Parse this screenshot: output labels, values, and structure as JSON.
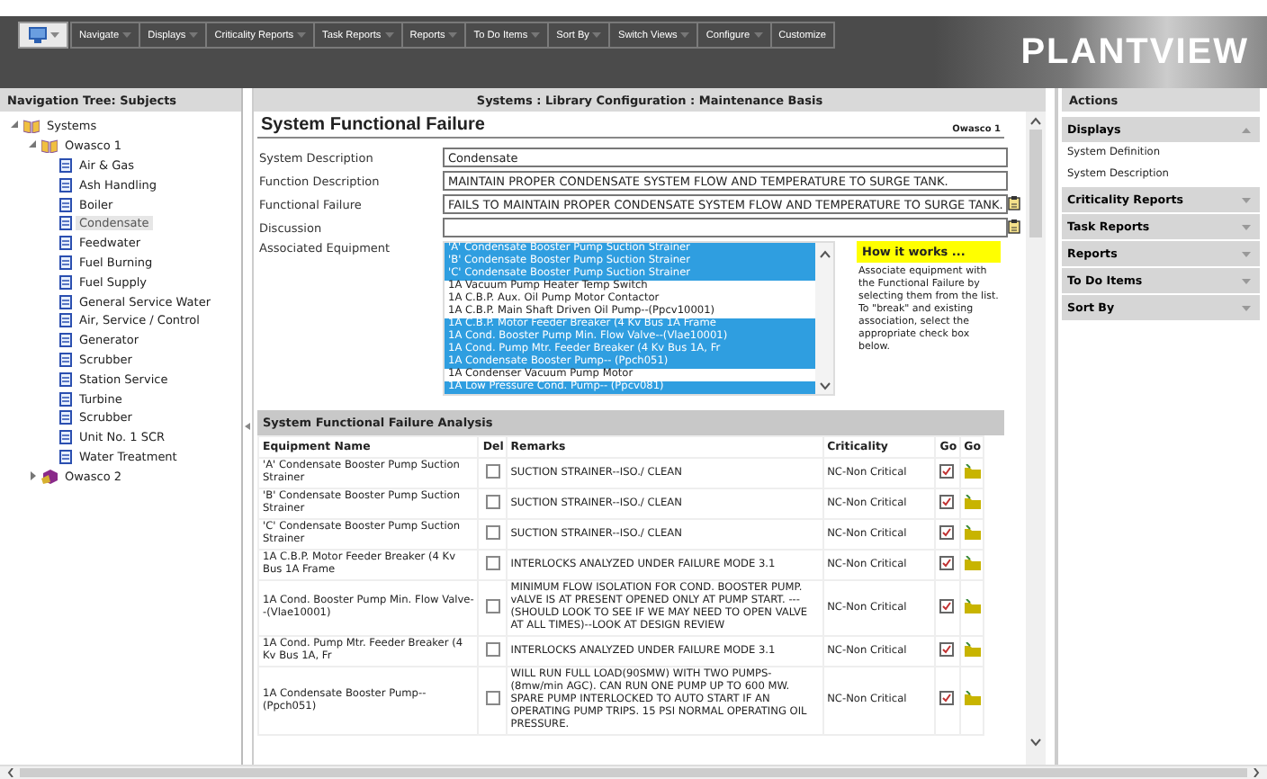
{
  "toolbar": {
    "menus": [
      {
        "label": "Navigate",
        "dropdown": true
      },
      {
        "label": "Displays",
        "dropdown": true
      },
      {
        "label": "Criticality Reports",
        "dropdown": true
      },
      {
        "label": "Task Reports",
        "dropdown": true
      },
      {
        "label": "Reports",
        "dropdown": true
      },
      {
        "label": "To Do Items",
        "dropdown": true
      },
      {
        "label": "Sort By",
        "dropdown": true
      },
      {
        "label": "Switch Views",
        "dropdown": true
      },
      {
        "label": "Configure",
        "dropdown": true
      },
      {
        "label": "Customize",
        "dropdown": false
      }
    ],
    "logo": "PLANTVIEW"
  },
  "nav": {
    "title": "Navigation Tree: Subjects",
    "tree": [
      {
        "label": "Systems",
        "kind": "library",
        "expanded": true,
        "selected": false,
        "children": [
          {
            "label": "Owasco 1",
            "kind": "library",
            "expanded": true,
            "selected": false,
            "children": [
              {
                "label": "Air & Gas",
                "kind": "page",
                "selected": false
              },
              {
                "label": "Ash Handling",
                "kind": "page",
                "selected": false
              },
              {
                "label": "Boiler",
                "kind": "page",
                "selected": false
              },
              {
                "label": "Condensate",
                "kind": "page",
                "selected": true
              },
              {
                "label": "Feedwater",
                "kind": "page",
                "selected": false
              },
              {
                "label": "Fuel Burning",
                "kind": "page",
                "selected": false
              },
              {
                "label": "Fuel Supply",
                "kind": "page",
                "selected": false
              },
              {
                "label": "General Service Water",
                "kind": "page",
                "selected": false
              },
              {
                "label": "Air, Service / Control",
                "kind": "page",
                "selected": false
              },
              {
                "label": "Generator",
                "kind": "page",
                "selected": false
              },
              {
                "label": "Scrubber",
                "kind": "page",
                "selected": false
              },
              {
                "label": "Station Service",
                "kind": "page",
                "selected": false
              },
              {
                "label": "Turbine",
                "kind": "page",
                "selected": false
              },
              {
                "label": "Scrubber",
                "kind": "page",
                "selected": false
              },
              {
                "label": "Unit No. 1 SCR",
                "kind": "page",
                "selected": false
              },
              {
                "label": "Water Treatment",
                "kind": "page",
                "selected": false
              }
            ]
          },
          {
            "label": "Owasco 2",
            "kind": "site",
            "expanded": false,
            "selected": false
          }
        ]
      }
    ]
  },
  "breadcrumb": "Systems : Library Configuration : Maintenance Basis",
  "form": {
    "title": "System Functional Failure",
    "subject": "Owasco 1",
    "fields": [
      {
        "label": "System Description",
        "value": "Condensate",
        "note": false
      },
      {
        "label": "Function Description",
        "value": "MAINTAIN PROPER CONDENSATE SYSTEM FLOW AND TEMPERATURE TO SURGE TANK.",
        "note": false
      },
      {
        "label": "Functional Failure",
        "value": "FAILS TO MAINTAIN PROPER CONDENSATE SYSTEM FLOW AND TEMPERATURE TO SURGE TANK.",
        "note": true
      },
      {
        "label": "Discussion",
        "note": true
      }
    ],
    "equipment": {
      "label": "Associated Equipment",
      "items": [
        {
          "text": "'A' Condensate Booster Pump Suction Strainer",
          "selected": true
        },
        {
          "text": "'B' Condensate Booster Pump Suction Strainer",
          "selected": true
        },
        {
          "text": "'C' Condensate Booster Pump Suction Strainer",
          "selected": true
        },
        {
          "text": "1A  Vacuum Pump Heater Temp Switch",
          "selected": false
        },
        {
          "text": "1A C.B.P. Aux. Oil Pump Motor Contactor",
          "selected": false
        },
        {
          "text": "1A C.B.P. Main Shaft Driven Oil Pump--(Ppcv10001)",
          "selected": false
        },
        {
          "text": "1A C.B.P. Motor Feeder Breaker (4 Kv Bus 1A Frame",
          "selected": true
        },
        {
          "text": "1A Cond. Booster Pump Min. Flow Valve--(Vlae10001)",
          "selected": true
        },
        {
          "text": "1A Cond. Pump Mtr. Feeder Breaker (4 Kv Bus 1A, Fr",
          "selected": true
        },
        {
          "text": "1A Condensate Booster Pump-- (Ppch051)",
          "selected": true
        },
        {
          "text": "1A Condenser Vacuum Pump Motor",
          "selected": false
        },
        {
          "text": "1A Low Pressure Cond. Pump-- (Ppcv081)",
          "selected": true
        }
      ]
    },
    "help": {
      "title": "How it works ...",
      "text": "Associate equipment with the Functional Failure by selecting them from the list. To \"break\" and existing association, select the appropriate check box below."
    }
  },
  "analysis": {
    "title": "System Functional Failure Analysis",
    "columns": [
      "Equipment Name",
      "Del",
      "Remarks",
      "Criticality",
      "Go",
      "Go"
    ],
    "rows": [
      {
        "equipment": "'A' Condensate Booster Pump Suction Strainer",
        "del": false,
        "remarks": "SUCTION STRAINER--ISO./ CLEAN",
        "criticality": "NC-Non Critical"
      },
      {
        "equipment": "'B' Condensate Booster Pump Suction Strainer",
        "del": false,
        "remarks": "SUCTION STRAINER--ISO./ CLEAN",
        "criticality": "NC-Non Critical"
      },
      {
        "equipment": "'C' Condensate Booster Pump Suction Strainer",
        "del": false,
        "remarks": "SUCTION STRAINER--ISO./ CLEAN",
        "criticality": "NC-Non Critical"
      },
      {
        "equipment": "1A C.B.P. Motor Feeder Breaker (4 Kv Bus 1A Frame",
        "del": false,
        "remarks": "INTERLOCKS ANALYZED UNDER FAILURE MODE 3.1",
        "criticality": "NC-Non Critical"
      },
      {
        "equipment": "1A Cond. Booster Pump Min. Flow Valve--(Vlae10001)",
        "del": false,
        "remarks": "MINIMUM FLOW ISOLATION FOR COND. BOOSTER PUMP. vALVE IS AT PRESENT OPENED ONLY AT PUMP START. ---(SHOULD LOOK TO SEE IF WE MAY NEED TO OPEN VALVE AT ALL TIMES)--LOOK AT DESIGN REVIEW",
        "criticality": "NC-Non Critical"
      },
      {
        "equipment": "1A Cond. Pump Mtr. Feeder Breaker (4 Kv Bus 1A, Fr",
        "del": false,
        "remarks": "INTERLOCKS ANALYZED UNDER FAILURE MODE 3.1",
        "criticality": "NC-Non Critical"
      },
      {
        "equipment": "1A Condensate Booster Pump-- (Ppch051)",
        "del": false,
        "remarks": "WILL RUN FULL LOAD(90SMW) WITH TWO PUMPS-(8mw/min AGC). CAN RUN ONE PUMP UP TO 600 MW. SPARE PUMP INTERLOCKED TO AUTO START IF AN OPERATING PUMP TRIPS. 15 PSI NORMAL OPERATING OIL PRESSURE.",
        "criticality": "NC-Non Critical"
      }
    ]
  },
  "actions": {
    "title": "Actions",
    "groups": [
      {
        "label": "Displays",
        "expanded": true,
        "items": [
          "System Definition",
          "System Description"
        ]
      },
      {
        "label": "Criticality Reports",
        "expanded": false
      },
      {
        "label": "Task Reports",
        "expanded": false
      },
      {
        "label": "Reports",
        "expanded": false
      },
      {
        "label": "To Do Items",
        "expanded": false
      },
      {
        "label": "Sort By",
        "expanded": false
      }
    ]
  }
}
